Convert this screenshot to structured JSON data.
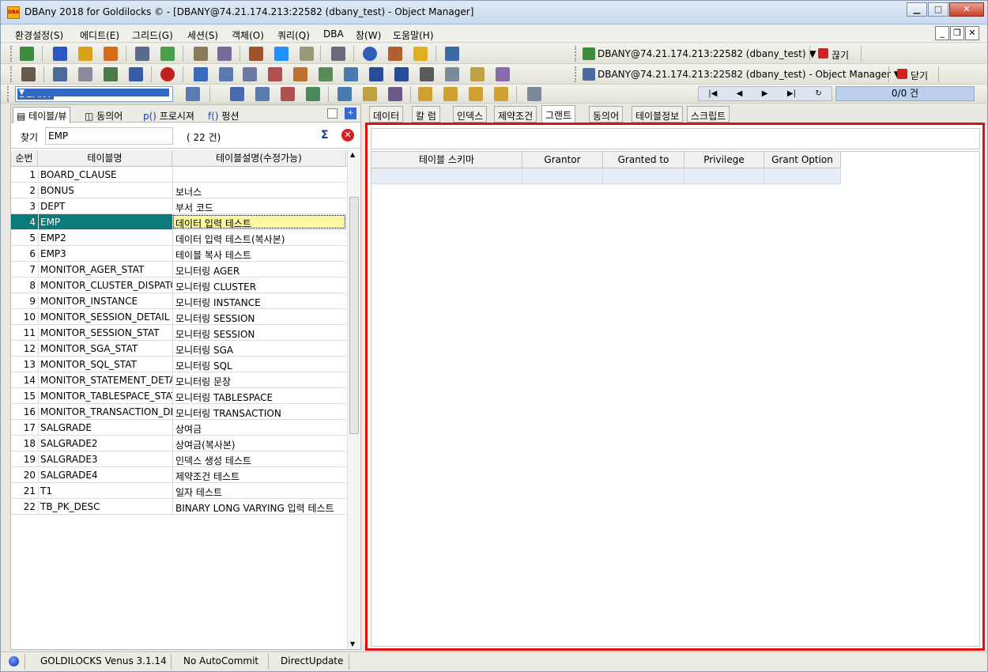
{
  "window": {
    "title": "DBAny 2018 for Goldilocks © - [DBANY@74.21.174.213:22582 (dbany_test) - Object Manager]",
    "app_icon_text": "DBA"
  },
  "menu": [
    "환경설정(S)",
    "에디트(E)",
    "그리드(G)",
    "세션(S)",
    "객체(O)",
    "쿼리(Q)",
    "DBA",
    "창(W)",
    "도움말(H)"
  ],
  "toolbar": {
    "connection_label": "DBANY@74.21.174.213:22582 (dbany_test) ▼",
    "disconnect_label": "끊기",
    "window_label": "DBANY@74.21.174.213:22582 (dbany_test) - Object Manager ▼",
    "close_label": "닫기",
    "db_select": "DBANY",
    "record_count": "0/0 건"
  },
  "left": {
    "tabs": [
      "테이블/뷰",
      "동의어",
      "프로시져",
      "펑션"
    ],
    "find_label": "찾기",
    "find_value": "EMP",
    "count": "( 22 건)",
    "columns": [
      "순번",
      "테이블명",
      "테이블설명(수정가능)"
    ],
    "rows": [
      [
        "1",
        "BOARD_CLAUSE",
        ""
      ],
      [
        "2",
        "BONUS",
        "보너스"
      ],
      [
        "3",
        "DEPT",
        "부서 코드"
      ],
      [
        "4",
        "EMP",
        "데이터 입력 테스트"
      ],
      [
        "5",
        "EMP2",
        "데이터 입력 테스트(복사본)"
      ],
      [
        "6",
        "EMP3",
        "테이블 복사 테스트"
      ],
      [
        "7",
        "MONITOR_AGER_STAT",
        "모니터링 AGER"
      ],
      [
        "8",
        "MONITOR_CLUSTER_DISPATCH",
        "모니터링 CLUSTER"
      ],
      [
        "9",
        "MONITOR_INSTANCE",
        "모니터링 INSTANCE"
      ],
      [
        "10",
        "MONITOR_SESSION_DETAIL",
        "모니터링 SESSION"
      ],
      [
        "11",
        "MONITOR_SESSION_STAT",
        "모니터링 SESSION"
      ],
      [
        "12",
        "MONITOR_SGA_STAT",
        "모니터링 SGA"
      ],
      [
        "13",
        "MONITOR_SQL_STAT",
        "모니터링 SQL"
      ],
      [
        "14",
        "MONITOR_STATEMENT_DETAIL",
        "모니터링 문장"
      ],
      [
        "15",
        "MONITOR_TABLESPACE_STAT",
        "모니터링 TABLESPACE"
      ],
      [
        "16",
        "MONITOR_TRANSACTION_DETAIL",
        "모니터링 TRANSACTION"
      ],
      [
        "17",
        "SALGRADE",
        "상여금"
      ],
      [
        "18",
        "SALGRADE2",
        "상여금(복사본)"
      ],
      [
        "19",
        "SALGRADE3",
        "인덱스 생성 테스트"
      ],
      [
        "20",
        "SALGRADE4",
        "제약조건 테스트"
      ],
      [
        "21",
        "T1",
        "일자 테스트"
      ],
      [
        "22",
        "TB_PK_DESC",
        "BINARY LONG VARYING 입력 테스트"
      ]
    ],
    "selected_row": "4"
  },
  "right": {
    "tabs": [
      "데이터",
      "칼 럼",
      "인덱스",
      "제약조건",
      "그랜트",
      "동의어",
      "테이블정보",
      "스크립트"
    ],
    "active_tab": "그랜트",
    "columns": [
      "테이블 스키마",
      "Grantor",
      "Granted to",
      "Privilege",
      "Grant Option"
    ]
  },
  "status": {
    "server": "GOLDILOCKS Venus 3.1.14",
    "autocommit": "No AutoCommit",
    "update_mode": "DirectUpdate"
  },
  "colors": {
    "selection": "#0a7a7a",
    "highlight_border": "#e01010",
    "edit_cell": "#fffaa0"
  }
}
